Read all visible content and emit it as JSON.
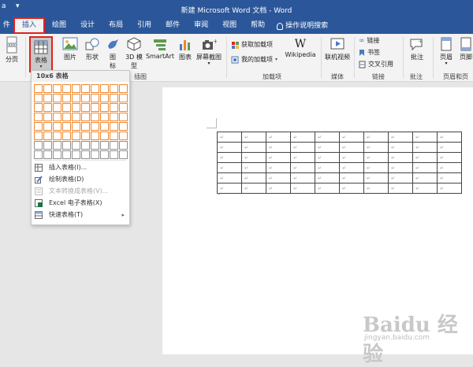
{
  "window": {
    "title": "新建 Microsoft Word 文档 - Word"
  },
  "quick_access": {
    "left_char": "a",
    "chevron": "▾"
  },
  "tabs": [
    {
      "label": "件",
      "name": "file"
    },
    {
      "label": "插入",
      "name": "insert",
      "active": true
    },
    {
      "label": "绘图",
      "name": "draw"
    },
    {
      "label": "设计",
      "name": "design"
    },
    {
      "label": "布局",
      "name": "layout"
    },
    {
      "label": "引用",
      "name": "references"
    },
    {
      "label": "邮件",
      "name": "mailings"
    },
    {
      "label": "审阅",
      "name": "review"
    },
    {
      "label": "视图",
      "name": "view"
    },
    {
      "label": "帮助",
      "name": "help"
    }
  ],
  "tell_me": {
    "label": "操作说明搜索",
    "icon": "lightbulb-icon"
  },
  "ribbon": {
    "page_break": "分页",
    "table": "表格",
    "picture": "图片",
    "shapes": "形状",
    "icons_line1": "图",
    "icons_line2": "标",
    "model3d_line1": "3D 模",
    "model3d_line2": "型",
    "smartart": "SmartArt",
    "chart": "图表",
    "screenshot": "屏幕截图",
    "get_addins": "获取加载项",
    "my_addins": "我的加载项",
    "wikipedia": "Wikipedia",
    "wiki_glyph": "W",
    "online_video": "联机视频",
    "link": "链接",
    "bookmark": "书签",
    "crossref": "交叉引用",
    "comment": "批注",
    "header": "页眉",
    "footer": "页脚",
    "groups": {
      "illustrations": "插图",
      "addins": "加载项",
      "media": "媒体",
      "links": "链接",
      "comments": "批注",
      "header_footer": "页眉和页"
    }
  },
  "dropdown": {
    "header": "10x6 表格",
    "grid_cols": 10,
    "grid_rows": 8,
    "highlight_cols": 10,
    "highlight_rows": 6,
    "items": [
      {
        "label": "插入表格(I)...",
        "icon": "table-grid-icon",
        "enabled": true
      },
      {
        "label": "绘制表格(D)",
        "icon": "pencil-icon",
        "enabled": true
      },
      {
        "label": "文本转换成表格(V)...",
        "icon": "text-to-table-icon",
        "enabled": false
      },
      {
        "label": "Excel 电子表格(X)",
        "icon": "excel-icon",
        "enabled": true
      },
      {
        "label": "快速表格(T)",
        "icon": "quick-table-icon",
        "enabled": true,
        "submenu": "▸"
      }
    ]
  },
  "document": {
    "table_rows": 6,
    "table_cols": 10,
    "cell_mark": "↵",
    "para_mark": "↵"
  },
  "watermark": {
    "brand": "Baidu 经验",
    "url": "jingyan.baidu.com"
  },
  "colors": {
    "title_blue": "#2b579a",
    "highlight_red": "#e0221e",
    "grid_orange": "#f0862a"
  }
}
